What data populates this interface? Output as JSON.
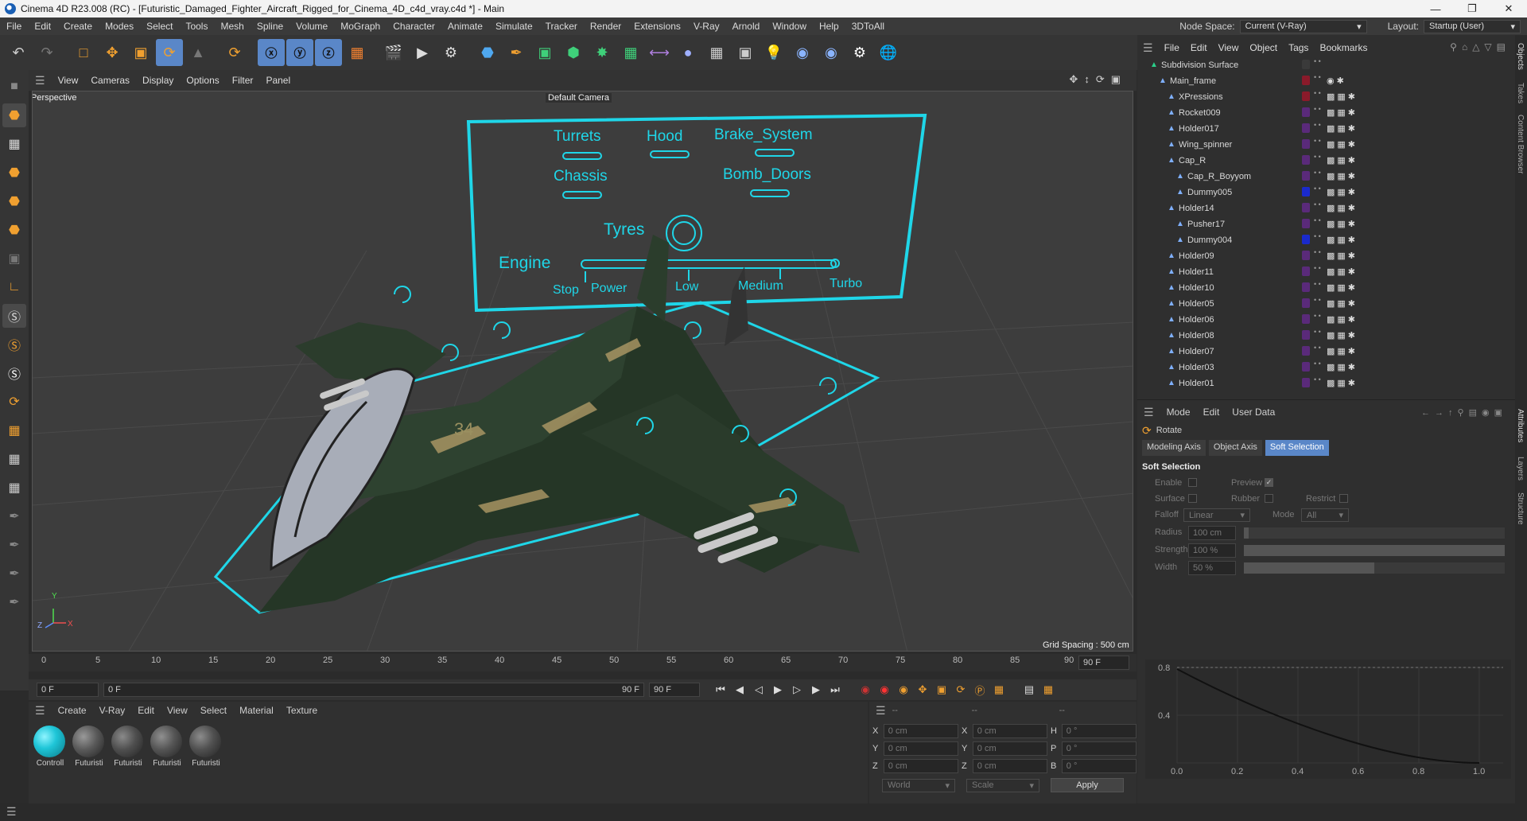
{
  "window": {
    "title": "Cinema 4D R23.008 (RC) - [Futuristic_Damaged_Fighter_Aircraft_Rigged_for_Cinema_4D_c4d_vray.c4d *] - Main",
    "minimize": "—",
    "maximize": "❐",
    "close": "✕"
  },
  "menubar": {
    "items": [
      "File",
      "Edit",
      "Create",
      "Modes",
      "Select",
      "Tools",
      "Mesh",
      "Spline",
      "Volume",
      "MoGraph",
      "Character",
      "Animate",
      "Simulate",
      "Tracker",
      "Render",
      "Extensions",
      "V-Ray",
      "Arnold",
      "Window",
      "Help",
      "3DToAll"
    ],
    "node_space_label": "Node Space:",
    "node_space_value": "Current (V-Ray)",
    "layout_label": "Layout:",
    "layout_value": "Startup (User)"
  },
  "viewport": {
    "menu": [
      "View",
      "Cameras",
      "Display",
      "Options",
      "Filter",
      "Panel"
    ],
    "view_name": "Perspective",
    "camera_name": "Default Camera",
    "grid_spacing": "Grid Spacing : 500 cm",
    "hud": {
      "turrets": "Turrets",
      "hood": "Hood",
      "brake": "Brake_System",
      "chassis": "Chassis",
      "bomb": "Bomb_Doors",
      "tyres": "Tyres",
      "engine": "Engine",
      "stop": "Stop",
      "power": "Power",
      "low": "Low",
      "medium": "Medium",
      "turbo": "Turbo"
    },
    "axis": {
      "x": "X",
      "y": "Y",
      "z": "Z"
    }
  },
  "timeline": {
    "ticks": [
      "0",
      "5",
      "10",
      "15",
      "20",
      "25",
      "30",
      "35",
      "40",
      "45",
      "50",
      "55",
      "60",
      "65",
      "70",
      "75",
      "80",
      "85",
      "90"
    ],
    "end_field": "90 F",
    "current_frame": "0 F",
    "start_field": "0 F",
    "range_end": "90 F",
    "max_frame": "90 F"
  },
  "materials": {
    "menu": [
      "Create",
      "V-Ray",
      "Edit",
      "View",
      "Select",
      "Material",
      "Texture"
    ],
    "items": [
      {
        "label": "Controll",
        "color": "#1fc6d8"
      },
      {
        "label": "Futuristi",
        "color": "#5a5a5a"
      },
      {
        "label": "Futuristi",
        "color": "#4f4f4f"
      },
      {
        "label": "Futuristi",
        "color": "#555555"
      },
      {
        "label": "Futuristi",
        "color": "#505050"
      }
    ]
  },
  "coordinates": {
    "header": [
      "--",
      "--",
      "--"
    ],
    "rows": [
      {
        "a": "X",
        "av": "0 cm",
        "b": "X",
        "bv": "0 cm",
        "c": "H",
        "cv": "0 °"
      },
      {
        "a": "Y",
        "av": "0 cm",
        "b": "Y",
        "bv": "0 cm",
        "c": "P",
        "cv": "0 °"
      },
      {
        "a": "Z",
        "av": "0 cm",
        "b": "Z",
        "bv": "0 cm",
        "c": "B",
        "cv": "0 °"
      }
    ],
    "world": "World",
    "scale": "Scale",
    "apply": "Apply"
  },
  "object_manager": {
    "menu": [
      "File",
      "Edit",
      "View",
      "Object",
      "Tags",
      "Bookmarks"
    ],
    "rows": [
      {
        "name": "Subdivision Surface",
        "indent": 0,
        "tag": "#3a3a3a",
        "icon": "#2ad08a"
      },
      {
        "name": "Main_frame",
        "indent": 1,
        "tag": "#8a1a2a",
        "icon": "#7fb0ff"
      },
      {
        "name": "XPressions",
        "indent": 2,
        "tag": "#8a1a2a",
        "icon": "#7fb0ff"
      },
      {
        "name": "Rocket009",
        "indent": 2,
        "tag": "#5a2a7a",
        "icon": "#7fb0ff"
      },
      {
        "name": "Holder017",
        "indent": 2,
        "tag": "#5a2a7a",
        "icon": "#7fb0ff"
      },
      {
        "name": "Wing_spinner",
        "indent": 2,
        "tag": "#5a2a7a",
        "icon": "#7fb0ff"
      },
      {
        "name": "Cap_R",
        "indent": 2,
        "tag": "#5a2a7a",
        "icon": "#7fb0ff"
      },
      {
        "name": "Cap_R_Boyyom",
        "indent": 3,
        "tag": "#5a2a7a",
        "icon": "#7fb0ff"
      },
      {
        "name": "Dummy005",
        "indent": 3,
        "tag": "#1a2acc",
        "icon": "#7fb0ff"
      },
      {
        "name": "Holder14",
        "indent": 2,
        "tag": "#5a2a7a",
        "icon": "#7fb0ff"
      },
      {
        "name": "Pusher17",
        "indent": 3,
        "tag": "#5a2a7a",
        "icon": "#7fb0ff"
      },
      {
        "name": "Dummy004",
        "indent": 3,
        "tag": "#1a2acc",
        "icon": "#7fb0ff"
      },
      {
        "name": "Holder09",
        "indent": 2,
        "tag": "#5a2a7a",
        "icon": "#7fb0ff"
      },
      {
        "name": "Holder11",
        "indent": 2,
        "tag": "#5a2a7a",
        "icon": "#7fb0ff"
      },
      {
        "name": "Holder10",
        "indent": 2,
        "tag": "#5a2a7a",
        "icon": "#7fb0ff"
      },
      {
        "name": "Holder05",
        "indent": 2,
        "tag": "#5a2a7a",
        "icon": "#7fb0ff"
      },
      {
        "name": "Holder06",
        "indent": 2,
        "tag": "#5a2a7a",
        "icon": "#7fb0ff"
      },
      {
        "name": "Holder08",
        "indent": 2,
        "tag": "#5a2a7a",
        "icon": "#7fb0ff"
      },
      {
        "name": "Holder07",
        "indent": 2,
        "tag": "#5a2a7a",
        "icon": "#7fb0ff"
      },
      {
        "name": "Holder03",
        "indent": 2,
        "tag": "#5a2a7a",
        "icon": "#7fb0ff"
      },
      {
        "name": "Holder01",
        "indent": 2,
        "tag": "#5a2a7a",
        "icon": "#7fb0ff"
      }
    ]
  },
  "attributes": {
    "menu": [
      "Mode",
      "Edit",
      "User Data"
    ],
    "tool": "Rotate",
    "tabs": [
      "Modeling Axis",
      "Object Axis",
      "Soft Selection"
    ],
    "section": "Soft Selection",
    "enable": "Enable",
    "preview": "Preview",
    "surface": "Surface",
    "rubber": "Rubber",
    "restrict": "Restrict",
    "falloff": "Falloff",
    "falloff_value": "Linear",
    "mode": "Mode",
    "mode_value": "All",
    "radius": "Radius",
    "radius_value": "100 cm",
    "strength": "Strength",
    "strength_value": "100 %",
    "width": "Width",
    "width_value": "50 %",
    "graph_y": [
      "0.8",
      "0.4"
    ],
    "graph_x": [
      "0.0",
      "0.2",
      "0.4",
      "0.6",
      "0.8",
      "1.0"
    ]
  },
  "side_tabs": [
    "Objects",
    "Takes",
    "Content Browser",
    "Attributes",
    "Layers",
    "Structure"
  ]
}
